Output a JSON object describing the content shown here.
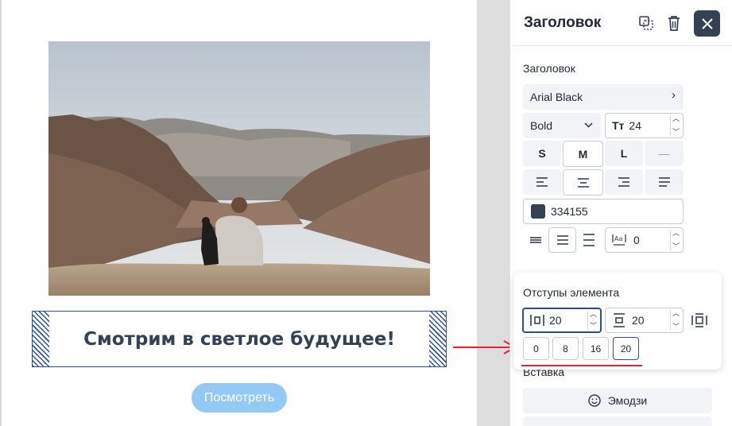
{
  "canvas": {
    "heading_text": "Смотрим в светлое будущее!",
    "button_label": "Посмотреть"
  },
  "panel": {
    "title": "Заголовок",
    "section_heading_label": "Заголовок",
    "font_family": "Arial Black",
    "font_weight": "Bold",
    "font_size": "24",
    "sizes": [
      "S",
      "M",
      "L",
      "—"
    ],
    "selected_size": "M",
    "color_hex": "334155",
    "color_swatch": "#334155",
    "letter_spacing": "0",
    "icons": {
      "duplicate": "duplicate-icon",
      "delete": "trash-icon",
      "close": "close-icon"
    }
  },
  "padding_popup": {
    "label": "Отступы элемента",
    "horizontal": "20",
    "vertical": "20",
    "presets": [
      "0",
      "8",
      "16",
      "20"
    ],
    "active_preset": "20"
  },
  "insert": {
    "label": "Вставка",
    "emoji_button": "Эмодзи"
  }
}
